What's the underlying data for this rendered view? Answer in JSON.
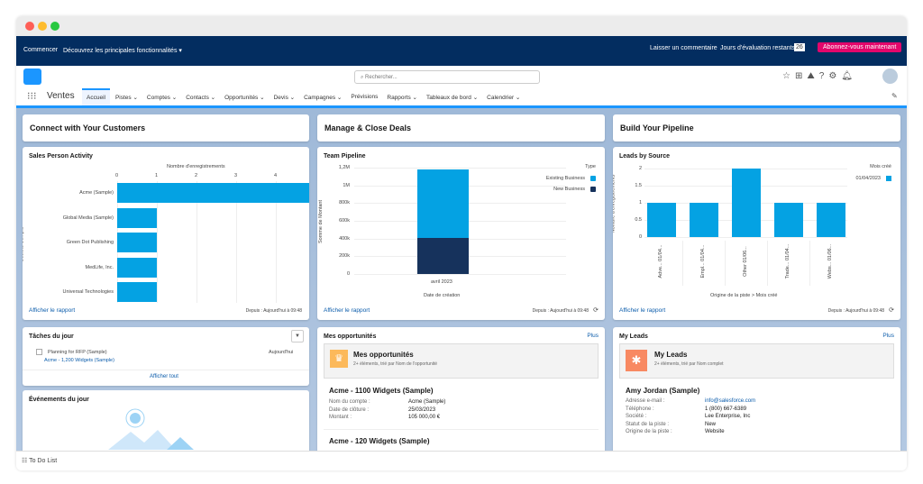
{
  "topbar": {
    "start": "Commencer",
    "discover": "Découvrez les principales fonctionnalités ▾",
    "feedback": "Laisser un commentaire",
    "trial_label": "Jours d'évaluation restants",
    "trial_days": "26",
    "subscribe": "Abonnez-vous maintenant"
  },
  "header": {
    "search_placeholder": "Rechercher...",
    "app_name": "Ventes",
    "nav": [
      {
        "label": "Accueil",
        "active": true
      },
      {
        "label": "Pistes ⌄"
      },
      {
        "label": "Comptes ⌄"
      },
      {
        "label": "Contacts ⌄"
      },
      {
        "label": "Opportunités ⌄"
      },
      {
        "label": "Devis ⌄"
      },
      {
        "label": "Campagnes ⌄"
      },
      {
        "label": "Prévisions"
      },
      {
        "label": "Rapports ⌄"
      },
      {
        "label": "Tableaux de bord ⌄"
      },
      {
        "label": "Calendrier ⌄"
      }
    ]
  },
  "sections": [
    "Connect with Your Customers",
    "Manage & Close Deals",
    "Build Your Pipeline"
  ],
  "common": {
    "view_report": "Afficher le rapport",
    "since": "Depuis : Aujourd'hui à 09:48"
  },
  "chart_data": [
    {
      "type": "bar",
      "orientation": "horizontal",
      "title": "Sales Person Activity",
      "xlabel": "Nombre d'enregistrements",
      "ylabel": "Société/Compte",
      "categories": [
        "Acme (Sample)",
        "Global Media (Sample)",
        "Green Dot Publishing",
        "MedLife, Inc.",
        "Universal Technologies"
      ],
      "values": [
        5,
        1,
        1,
        1,
        1
      ],
      "xlim": [
        0,
        5
      ],
      "xticks": [
        "0",
        "1",
        "2",
        "3",
        "4",
        "5"
      ],
      "color": "#04a2e3"
    },
    {
      "type": "bar",
      "stacked": true,
      "title": "Team Pipeline",
      "xlabel": "Date de création",
      "ylabel": "Somme de Montant",
      "categories": [
        "avril 2023"
      ],
      "legend_title": "Type",
      "legend": "top-right",
      "series": [
        {
          "name": "Existing Business",
          "values": [
            770000
          ],
          "color": "#04a2e3"
        },
        {
          "name": "New Business",
          "values": [
            410000
          ],
          "color": "#16325c"
        }
      ],
      "ylim": [
        0,
        1200000
      ],
      "yticks": [
        "0",
        "200k",
        "400k",
        "600k",
        "800k",
        "1M",
        "1,2M"
      ]
    },
    {
      "type": "bar",
      "title": "Leads by Source",
      "xlabel": "Origine de la piste > Mois créé",
      "ylabel": "Nombre d'enregistrements",
      "categories": [
        "Adve... 01/04...",
        "Empl... 01/04...",
        "Other 01/06...",
        "Trade... 01/04...",
        "Webs... 01/06..."
      ],
      "legend_title": "Mois créé",
      "legend": "top-right",
      "series": [
        {
          "name": "01/04/2023",
          "values": [
            1,
            1,
            2,
            1,
            1
          ],
          "color": "#04a2e3"
        }
      ],
      "ylim": [
        0,
        2
      ],
      "yticks": [
        "0",
        "0.5",
        "1",
        "1.5",
        "2"
      ]
    }
  ],
  "tasks": {
    "title": "Tâches du jour",
    "item": "Planning for RFP (Sample)",
    "related": "Acme - 1,200 Widgets (Sample)",
    "due": "Aujourd'hui",
    "view_all": "Afficher tout"
  },
  "events": {
    "title": "Événements du jour"
  },
  "opps": {
    "title": "Mes opportunités",
    "more": "Plus",
    "list_title": "Mes opportunités",
    "list_sub": "2+ éléments, trié par Nom de l'opportunité",
    "items": [
      {
        "name": "Acme - 1100 Widgets (Sample)",
        "fields": [
          [
            "Nom du compte :",
            "Acme (Sample)"
          ],
          [
            "Date de clôture :",
            "25/03/2023"
          ],
          [
            "Montant :",
            "105 000,00 €"
          ]
        ]
      },
      {
        "name": "Acme - 120 Widgets (Sample)"
      }
    ]
  },
  "leads": {
    "title": "My Leads",
    "more": "Plus",
    "list_title": "My Leads",
    "list_sub": "2+ éléments, trié par Nom complet",
    "name": "Amy Jordan (Sample)",
    "fields": [
      [
        "Adresse e-mail :",
        "info@salesforce.com"
      ],
      [
        "Téléphone :",
        "1 (800) 667-6389"
      ],
      [
        "Société :",
        "Lee Enterprise, Inc"
      ],
      [
        "Statut de la piste :",
        "New"
      ],
      [
        "Origine de la piste :",
        "Website"
      ]
    ]
  },
  "footer": {
    "todo": "To Do List"
  }
}
